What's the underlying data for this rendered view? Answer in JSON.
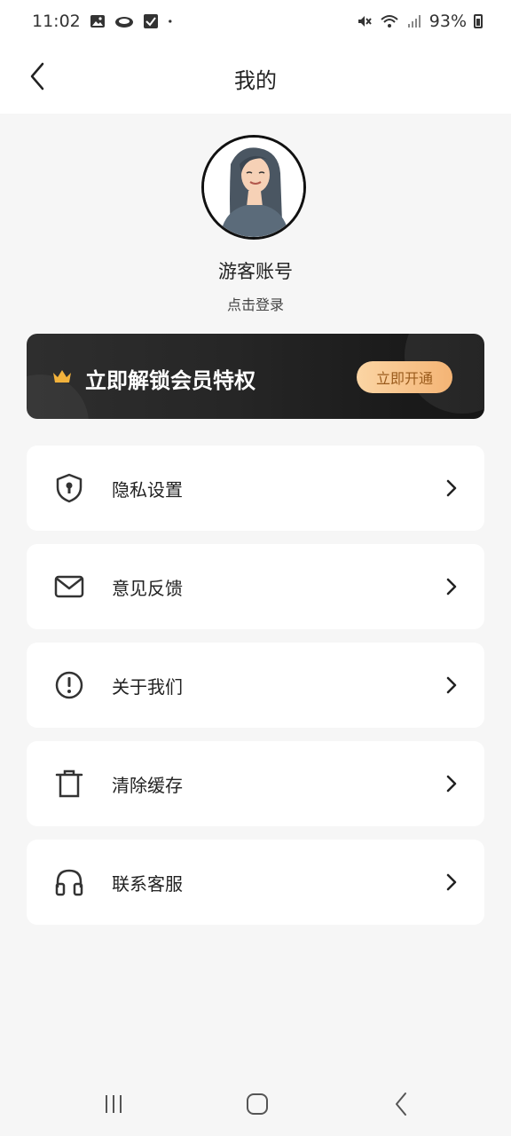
{
  "status_bar": {
    "time": "11:02",
    "battery": "93%",
    "icons": [
      "image-icon",
      "cloud-icon",
      "check-box-icon",
      "dot-icon",
      "mute-icon",
      "wifi-icon",
      "signal-icon",
      "battery-icon"
    ]
  },
  "header": {
    "title": "我的",
    "back_icon": "chevron-left-icon"
  },
  "profile": {
    "name": "游客账号",
    "login_text": "点击登录"
  },
  "vip": {
    "title": "立即解锁会员特权",
    "button_label": "立即开通",
    "icon": "crown-icon",
    "accent_color": "#f4b475"
  },
  "menu": {
    "items": [
      {
        "label": "隐私设置",
        "icon": "shield-lock-icon"
      },
      {
        "label": "意见反馈",
        "icon": "mail-icon"
      },
      {
        "label": "关于我们",
        "icon": "info-alert-icon"
      },
      {
        "label": "清除缓存",
        "icon": "trash-icon"
      },
      {
        "label": "联系客服",
        "icon": "headset-icon"
      }
    ]
  },
  "nav": {
    "icons": [
      "recent-apps-icon",
      "home-icon",
      "back-icon"
    ]
  }
}
